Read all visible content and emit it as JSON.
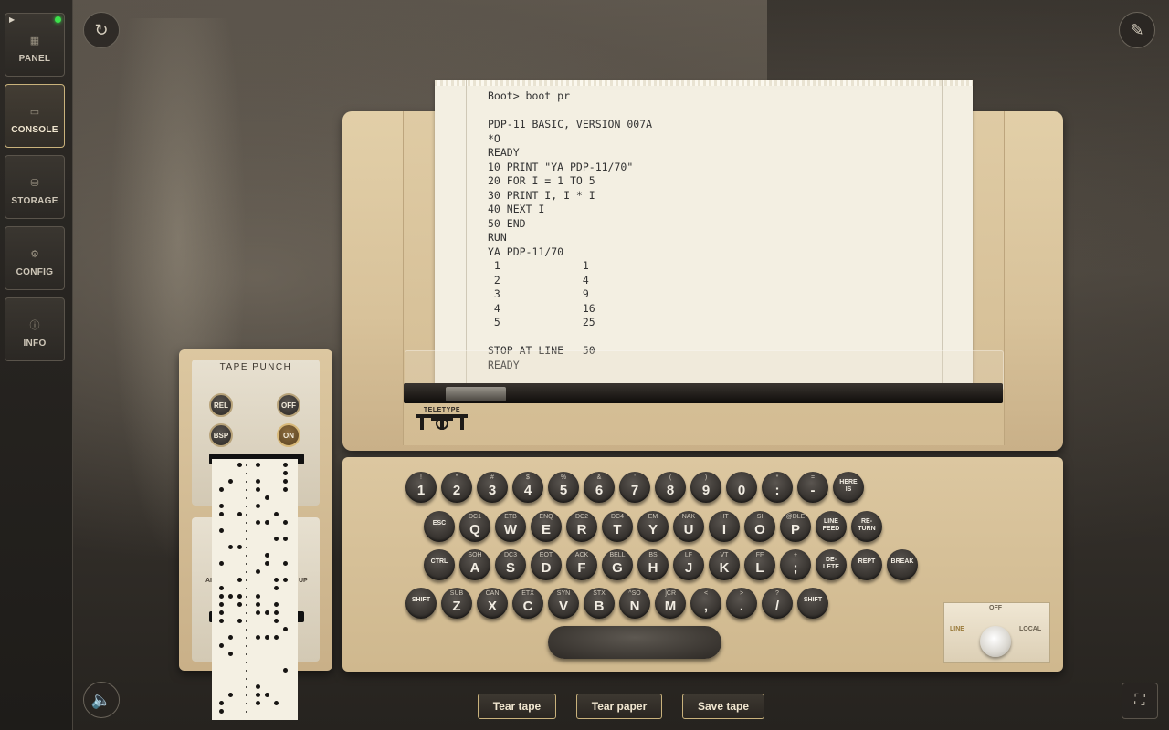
{
  "sidebar": {
    "items": [
      {
        "label": "PANEL",
        "icon": "panel-icon"
      },
      {
        "label": "CONSOLE",
        "icon": "console-icon",
        "active": true
      },
      {
        "label": "STORAGE",
        "icon": "storage-icon"
      },
      {
        "label": "CONFIG",
        "icon": "gear-icon"
      },
      {
        "label": "INFO",
        "icon": "info-icon"
      }
    ],
    "status_led_color": "#3be14b"
  },
  "toolbar": {
    "reset_icon": "refresh-icon",
    "magic_icon": "magic-wand-icon",
    "sound_icon": "speaker-icon",
    "fullscreen_icon": "fullscreen-icon"
  },
  "printout": {
    "lines": [
      "Boot> boot pr",
      "",
      "PDP-11 BASIC, VERSION 007A",
      "*O",
      "READY",
      "10 PRINT \"YA PDP-11/70\"",
      "20 FOR I = 1 TO 5",
      "30 PRINT I, I * I",
      "40 NEXT I",
      "50 END",
      "RUN",
      "YA PDP-11/70",
      " 1             1",
      " 2             4",
      " 3             9",
      " 4             16",
      " 5             25",
      "",
      "STOP AT LINE   50",
      "READY"
    ]
  },
  "teletype": {
    "logo_text": "TELETYPE"
  },
  "tape_punch": {
    "title": "TAPE PUNCH",
    "buttons": {
      "rel": "REL",
      "off": "OFF",
      "bsp": "BSP",
      "on": "ON"
    },
    "side_left": "AI",
    "side_right": "UP"
  },
  "keyboard": {
    "row1": [
      {
        "sh": "!",
        "mn": "1"
      },
      {
        "sh": "\"",
        "mn": "2"
      },
      {
        "sh": "#",
        "mn": "3"
      },
      {
        "sh": "$",
        "mn": "4"
      },
      {
        "sh": "%",
        "mn": "5"
      },
      {
        "sh": "&",
        "mn": "6"
      },
      {
        "sh": "'",
        "mn": "7"
      },
      {
        "sh": "(",
        "mn": "8"
      },
      {
        "sh": ")",
        "mn": "9"
      },
      {
        "sh": "",
        "mn": "0"
      },
      {
        "sh": "*",
        "mn": ":"
      },
      {
        "sh": "=",
        "mn": "-"
      },
      {
        "sh": "",
        "mn": "HERE IS",
        "fn": true
      }
    ],
    "row2": [
      {
        "sh": "",
        "mn": "ESC",
        "fn": true
      },
      {
        "sh": "DC1",
        "mn": "Q"
      },
      {
        "sh": "ETB",
        "mn": "W"
      },
      {
        "sh": "ENQ",
        "mn": "E"
      },
      {
        "sh": "DC2",
        "mn": "R"
      },
      {
        "sh": "DC4",
        "mn": "T"
      },
      {
        "sh": "EM",
        "mn": "Y"
      },
      {
        "sh": "NAK",
        "mn": "U"
      },
      {
        "sh": "HT",
        "mn": "I"
      },
      {
        "sh": "SI",
        "mn": "O"
      },
      {
        "sh": "@DLE",
        "mn": "P"
      },
      {
        "sh": "",
        "mn": "LINE FEED",
        "fn": true
      },
      {
        "sh": "",
        "mn": "RE- TURN",
        "fn": true
      }
    ],
    "row3": [
      {
        "sh": "",
        "mn": "CTRL",
        "fn": true
      },
      {
        "sh": "SOH",
        "mn": "A"
      },
      {
        "sh": "DC3",
        "mn": "S"
      },
      {
        "sh": "EOT",
        "mn": "D"
      },
      {
        "sh": "ACK",
        "mn": "F"
      },
      {
        "sh": "BELL",
        "mn": "G"
      },
      {
        "sh": "BS",
        "mn": "H"
      },
      {
        "sh": "LF",
        "mn": "J"
      },
      {
        "sh": "VT",
        "mn": "K"
      },
      {
        "sh": "FF",
        "mn": "L"
      },
      {
        "sh": "+",
        "mn": ";"
      },
      {
        "sh": "",
        "mn": "DE- LETE",
        "fn": true
      },
      {
        "sh": "",
        "mn": "REPT",
        "fn": true
      },
      {
        "sh": "",
        "mn": "BREAK",
        "fn": true
      }
    ],
    "row4": [
      {
        "sh": "",
        "mn": "SHIFT",
        "fn": true
      },
      {
        "sh": "SUB",
        "mn": "Z"
      },
      {
        "sh": "CAN",
        "mn": "X"
      },
      {
        "sh": "ETX",
        "mn": "C"
      },
      {
        "sh": "SYN",
        "mn": "V"
      },
      {
        "sh": "STX",
        "mn": "B"
      },
      {
        "sh": "^SO",
        "mn": "N"
      },
      {
        "sh": "]CR",
        "mn": "M"
      },
      {
        "sh": "<",
        "mn": ","
      },
      {
        "sh": ">",
        "mn": "."
      },
      {
        "sh": "?",
        "mn": "/"
      },
      {
        "sh": "",
        "mn": "SHIFT",
        "fn": true
      }
    ]
  },
  "mode_switch": {
    "off": "OFF",
    "line": "LINE",
    "local": "LOCAL"
  },
  "actions": {
    "tear_tape": "Tear tape",
    "tear_paper": "Tear paper",
    "save_tape": "Save tape"
  }
}
